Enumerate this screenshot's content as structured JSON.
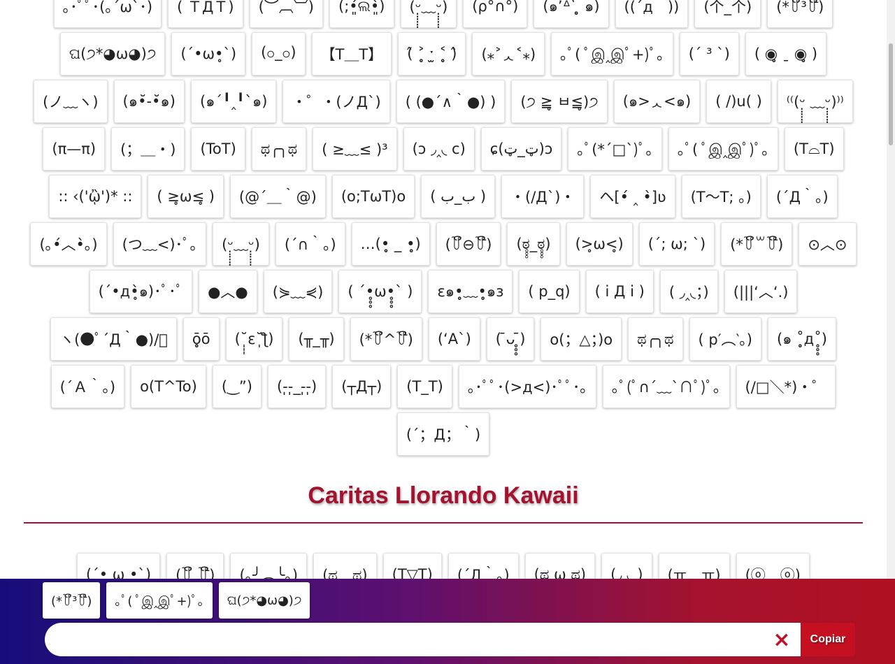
{
  "faces_top": [
    "｡･ﾟﾟ･(｡´ω`･)",
    "( ＴДＴ)",
    "(︶︹︺)",
    "(;•͈́ଲ•͈̀)",
    "(ᵕ̣̣̣̣̣̣﹏ᵕ̣̣̣̣̣̣)",
    "(ρ°∩°)",
    "(๑ʼᐞʽ ̥̥̥̥̥̥̥ ๑)",
    "((´д｀))",
    "(个_个)",
    "(*꒦ິ³꒦ີ)",
    "ଘ(੭*◕ω◕)੭",
    "(´•ω•̥`)",
    "(ဝ_ဝ)",
    "【T＿T】",
    "(̂ ˃̥̥̥ ˑ̫ ˂̥̥̥ )̂",
    "(⁎˃ᆺ˂⁎)",
    "｡ﾟ( ﾟஇ‸இﾟ+)ﾟ｡",
    "(´ ³ `)",
    "( ◉̥̥̥ ˍ ◉̥̥̥ )",
    "(ノ﹏ヽ)",
    "(๑•̆-•̆๑)",
    "(๑´╹‸╹`๑)",
    "・゜・(ノД`)",
    "( (●´∧｀●) )",
    "(੭ ≧̥ ㅂ≦̥)੭",
    "(๑>ᆺ<๑)",
    "( /)u( )",
    "⁽⁽(ᵕ̣̣̣̣̣̣ ﹏ᵕ̣̣̣̣̣̣)⁾⁾",
    "(π—π)",
    "(；＿・)",
    "(ToT)",
    "ಥ╭╮ಥ",
    "( ≥﹏≤ )³",
    "(ɔ ◞‸◟ c)",
    "ɕ(ټ_ټ)ɔ",
    "｡ﾟ(*´□`)ﾟ｡",
    "｡ﾟ( ﾟஇ‸இﾟ)ﾟ｡",
    "(T⌓T)",
    ":: ‹('ᾢ')* ::",
    "( ≥̥ω≤̥ )",
    "(@´＿｀@)",
    "(o;TωT)o",
    "( ب_ب )",
    "・(/Д`)・",
    "ヘ[•́ ‸ •̀]ʋ",
    "(T～T; 。)",
    "(´Д｀。)",
    "(｡•́︿•̀｡)",
    "(つ﹏<)･ﾟ｡",
    "(ᵕ̣̣̣̣̣̣﹏ᵕ̣̣̣̣̣̣)",
    "(´∩｀。)",
    "…(•̥̥̥ _ •̥̥̥)",
    "(꒦ິ⊖꒦ີ)",
    "(ಠ̥̥̥_ಠ̥̥̥)",
    "(>̥ω<̥)",
    "(´; ω; `)",
    "(*꒦ິ꒳꒦ີ)",
    "⊙︿⊙",
    "(´•д•̥̀๑)･ﾟ･ﾟ",
    "●︿●",
    "(⋟﹏⋞)",
    "( ´•̥̥̥ω•̥̥̥` )",
    "ε๑•̥̥̥﹏•̥̥̥๑з",
    "( p_q)",
    "( i Д i )",
    "( ◞‸◟；)",
    "(|||‘︿‘.)",
    "ヽ(●ﾟ´Д｀●)/ﾟ",
    "ō̥̥̥̥ō",
    "(˘̩̩̩ε˘̩ƪ)",
    "(╥_╥)",
    "(*꒦ິ^꒦ີ)",
    "(‘A`)",
    "( ̄ᴗ ̥̥̥̄)",
    "o(；△；)o",
    "ಥ╭╮ಥ",
    "( p′︵‵。)",
    "(๑ ˚̥̥̥д˚̥̥̥)",
    "(´Ａ｀。)",
    "o(T^To)",
    "(‿”)",
    "(-̩̩-̩̩_-̩̩-̩̩)",
    "(┬Д┬)",
    "(T_T)",
    "｡･ﾟﾟ･(>д<)･ﾟﾟ･｡",
    "｡ﾟ(ﾟ∩´﹏`∩ﾟ)ﾟ｡",
    "(/□＼*)・゜",
    "(´；Д；｀)"
  ],
  "section": {
    "title": "Caritas Llorando Kawaii"
  },
  "faces_kawaii": [
    "(´• ω •`)",
    "(꒦ິ‸꒦ີ)",
    "(｡╯︵╰｡)",
    "(ಥ﹏ಥ)",
    "(T▽T)",
    "(´Д｀。)",
    "(ಥ ω ಥ)",
    "(◞‸◟ )",
    "(ㅠ﹏ㅠ)",
    "(ⓞ﹏ⓞ)"
  ],
  "bottom_bar": {
    "recent": [
      "(*꒦ິ³꒦ີ)",
      "｡ﾟ( ﾟஇ‸இﾟ+)ﾟ｡",
      "ଘ(੭*◕ω◕)੭"
    ],
    "input_value": "",
    "clear_icon": "×",
    "copy_label": "Copiar"
  },
  "colors": {
    "accent": "#a3122f",
    "bar_gradient": [
      "#160d7a",
      "#5c1070",
      "#a4122e",
      "#b01020"
    ],
    "copy_button": "#c51021"
  }
}
